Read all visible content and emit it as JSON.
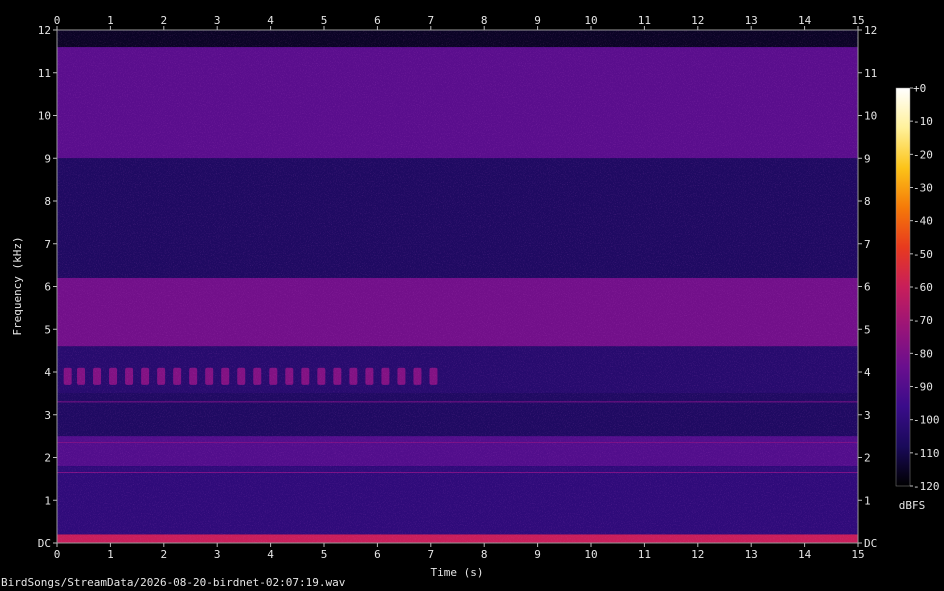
{
  "chart_data": {
    "type": "heatmap",
    "title": "",
    "xlabel": "Time (s)",
    "ylabel": "Frequency (kHz)",
    "xlim": [
      0,
      15
    ],
    "ylim": [
      0,
      12
    ],
    "x_ticks": [
      "0",
      "1",
      "2",
      "3",
      "4",
      "5",
      "6",
      "7",
      "8",
      "9",
      "10",
      "11",
      "12",
      "13",
      "14",
      "15"
    ],
    "y_ticks": [
      "DC",
      "1",
      "2",
      "3",
      "4",
      "5",
      "6",
      "7",
      "8",
      "9",
      "10",
      "11",
      "12"
    ],
    "colorbar": {
      "label": "dBFS",
      "range": [
        -120,
        0
      ],
      "ticks": [
        "+0",
        "-10",
        "-20",
        "-30",
        "-40",
        "-50",
        "-60",
        "-70",
        "-80",
        "-90",
        "-100",
        "-110",
        "-120"
      ],
      "colors": [
        "#000000",
        "#1a0a5a",
        "#3a0c8a",
        "#6a0f8e",
        "#9a1478",
        "#c81e5a",
        "#e83a1e",
        "#f57a08",
        "#fcc419",
        "#fff19a",
        "#ffffff"
      ]
    },
    "bands": [
      {
        "from_khz": 11.6,
        "to_khz": 12.0,
        "level_db": -115
      },
      {
        "from_khz": 9.0,
        "to_khz": 11.6,
        "level_db": -88
      },
      {
        "from_khz": 6.2,
        "to_khz": 9.0,
        "level_db": -106
      },
      {
        "from_khz": 4.6,
        "to_khz": 6.2,
        "level_db": -82
      },
      {
        "from_khz": 3.5,
        "to_khz": 4.6,
        "level_db": -103
      },
      {
        "from_khz": 2.5,
        "to_khz": 3.5,
        "level_db": -106
      },
      {
        "from_khz": 1.8,
        "to_khz": 2.5,
        "level_db": -90
      },
      {
        "from_khz": 0.2,
        "to_khz": 1.8,
        "level_db": -100
      },
      {
        "from_khz": 0.0,
        "to_khz": 0.2,
        "level_db": -60
      }
    ],
    "call_events_khz_range": [
      3.7,
      4.1
    ],
    "call_event_times_s": [
      0.2,
      0.45,
      0.75,
      1.05,
      1.35,
      1.65,
      1.95,
      2.25,
      2.55,
      2.85,
      3.15,
      3.45,
      3.75,
      4.05,
      4.35,
      4.65,
      4.95,
      5.25,
      5.55,
      5.85,
      6.15,
      6.45,
      6.75,
      7.05
    ],
    "tone_lines_khz": [
      1.65,
      2.35,
      3.3
    ]
  },
  "footer": {
    "filename": "BirdSongs/StreamData/2026-08-20-birdnet-02:07:19.wav"
  }
}
